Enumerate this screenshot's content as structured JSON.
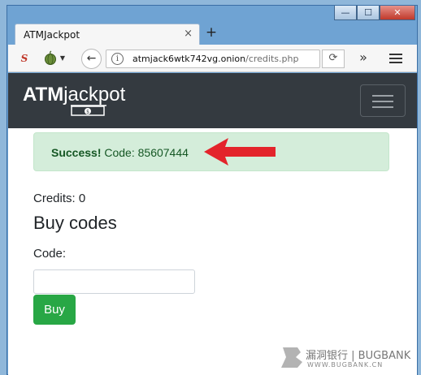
{
  "window": {
    "minimize_glyph": "—",
    "maximize_glyph": "☐",
    "close_glyph": "✕"
  },
  "tab": {
    "title": "ATMJackpot",
    "close_glyph": "×",
    "new_tab_glyph": "+"
  },
  "toolbar": {
    "back_glyph": "←",
    "info_glyph": "i",
    "url_host": "atmjack6wtk742vg.onion",
    "url_path": "/credits.php",
    "reload_glyph": "⟳",
    "overflow_glyph": "»",
    "extension_icons": [
      "s-icon",
      "onion-icon"
    ]
  },
  "navbar": {
    "brand_bold": "ATM",
    "brand_light": "jackpot"
  },
  "alert": {
    "strong": "Success!",
    "message": " Code: 85607444"
  },
  "credits": "Credits: 0",
  "heading": "Buy codes",
  "form": {
    "label": "Code:",
    "input_value": "",
    "button": "Buy"
  },
  "watermark": {
    "cn": "漏洞银行 | BUGBANK",
    "url": "WWW.BUGBANK.CN"
  },
  "colors": {
    "navbar": "#343a40",
    "success_bg": "#d4edda",
    "success_text": "#155724",
    "button": "#28a745",
    "arrow": "#e3242b"
  }
}
